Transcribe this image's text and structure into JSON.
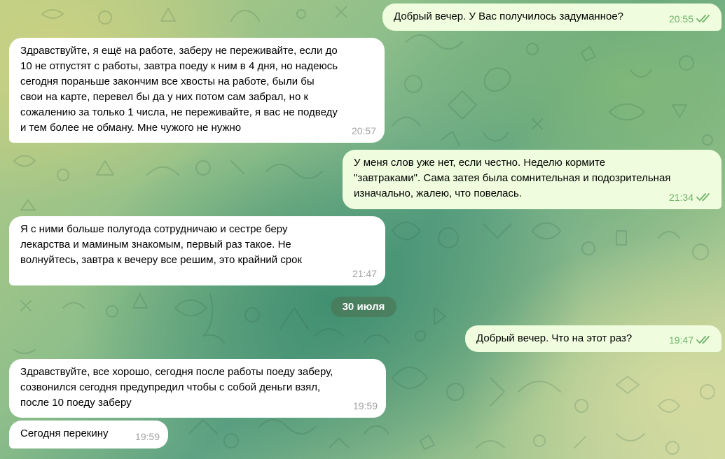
{
  "chat": {
    "messages": [
      {
        "direction": "out",
        "text": "Добрый вечер. У Вас получилось задуманное?",
        "time": "20:55",
        "read": true
      },
      {
        "direction": "in",
        "text": "Здравствуйте, я ещё на работе, заберу не переживайте, если до\n10 не отпустят с работы, завтра поеду к ним в 4 дня, но надеюсь\nсегодня пораньше закончим все хвосты на работе, были бы\nсвои на карте, перевел бы да у них потом сам забрал, но к\nсожалению за только 1 числа, не переживайте, я вас не подведу\nи тем более не обману. Мне чужого не нужно",
        "time": "20:57"
      },
      {
        "direction": "out",
        "text": "У меня слов уже нет, если честно. Неделю кормите\n\"завтраками\". Сама затея была сомнительная и подозрительная\nизначально, жалею, что повелась.",
        "time": "21:34",
        "read": true
      },
      {
        "direction": "in",
        "text": "Я с ними больше полугода сотрудничаю и сестре беру\nлекарства и маминым знакомым, первый раз такое. Не\nволнуйтесь, завтра к вечеру все решим, это крайний срок",
        "time": "21:47"
      },
      {
        "direction": "out",
        "text": "Добрый вечер. Что на этот раз?",
        "time": "19:47",
        "read": true
      },
      {
        "direction": "in",
        "text": "Здравствуйте, все хорошо, сегодня после работы поеду заберу,\nсозвонился сегодня предупредил чтобы с собой деньги взял,\nпосле 10 поеду заберу",
        "time": "19:59"
      },
      {
        "direction": "in",
        "text": "Сегодня перекину",
        "time": "19:59"
      }
    ],
    "date_separator": "30 июля"
  },
  "colors": {
    "incoming_bubble": "#ffffff",
    "outgoing_bubble": "#effdde",
    "outgoing_meta": "#6fb26a",
    "incoming_meta": "#a3a3a3",
    "date_pill": "#4a7858"
  },
  "icons": {
    "read_receipt": "double-check-icon"
  }
}
